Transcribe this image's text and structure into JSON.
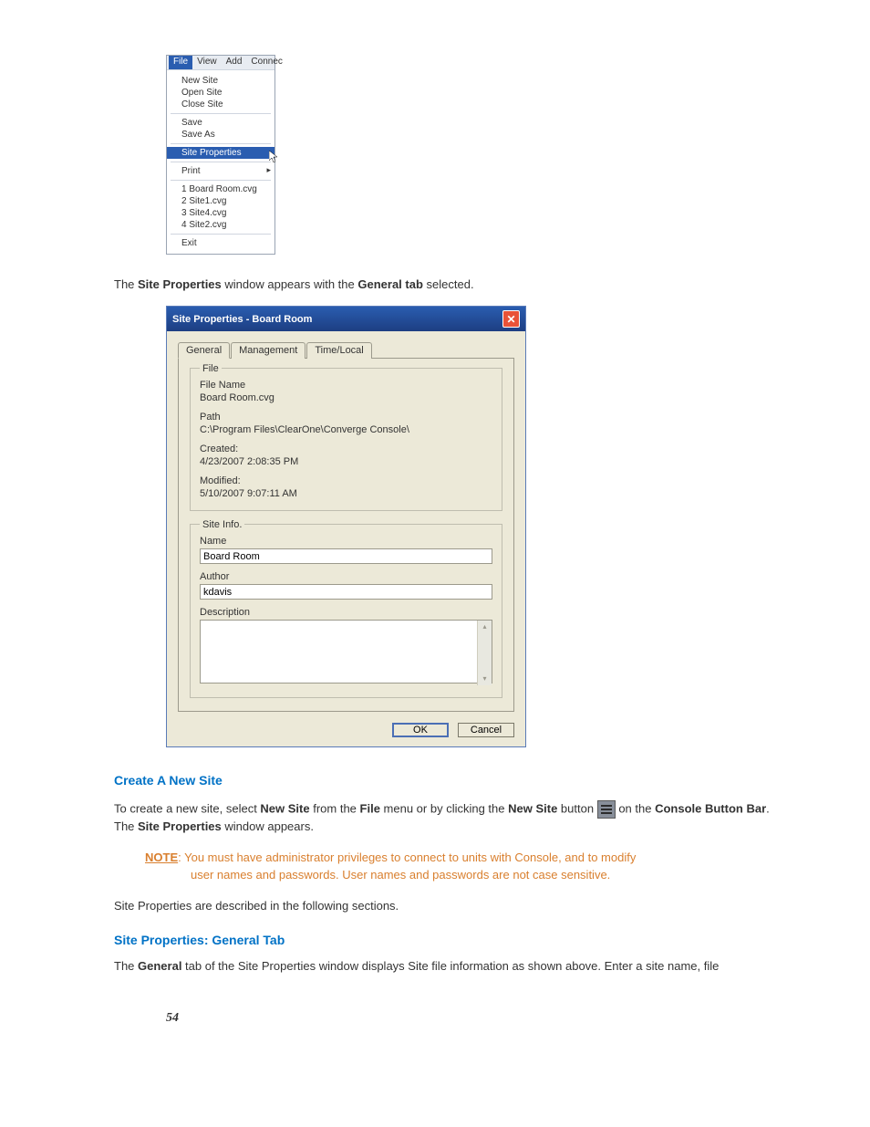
{
  "menu": {
    "bar": [
      "File",
      "View",
      "Add",
      "Connec"
    ],
    "groups": [
      [
        "New Site",
        "Open Site",
        "Close Site"
      ],
      [
        "Save",
        "Save As"
      ],
      [
        "Site Properties"
      ],
      [
        "Print"
      ],
      [
        "1  Board Room.cvg",
        "2  Site1.cvg",
        "3  Site4.cvg",
        "4  Site2.cvg"
      ],
      [
        "Exit"
      ]
    ],
    "highlighted": "Site Properties",
    "submenu_arrow_on": "Print"
  },
  "intro_line": {
    "pre": "The ",
    "b1": "Site Properties",
    "mid": " window appears with the ",
    "b2": "General tab",
    "post": " selected."
  },
  "dialog": {
    "title": "Site Properties - Board Room",
    "tabs": [
      "General",
      "Management",
      "Time/Local"
    ],
    "active_tab": "General",
    "file_group": {
      "legend": "File",
      "items": [
        {
          "k": "File Name",
          "v": "Board Room.cvg"
        },
        {
          "k": "Path",
          "v": "C:\\Program Files\\ClearOne\\Converge Console\\"
        },
        {
          "k": "Created:",
          "v": "4/23/2007 2:08:35 PM"
        },
        {
          "k": "Modified:",
          "v": "5/10/2007 9:07:11 AM"
        }
      ]
    },
    "site_group": {
      "legend": "Site Info.",
      "name_label": "Name",
      "name_value": "Board Room",
      "author_label": "Author",
      "author_value": "kdavis",
      "desc_label": "Description",
      "desc_value": ""
    },
    "buttons": {
      "ok": "OK",
      "cancel": "Cancel"
    }
  },
  "create_heading": "Create A New Site",
  "create_p": {
    "t1": "To create a new site, select ",
    "b1": "New Site",
    "t2": " from the ",
    "b2": "File",
    "t3": " menu or by clicking the ",
    "b3": "New Site",
    "t4": " button ",
    "t5": " on the ",
    "b4": "Console Button Bar",
    "t6": ". The ",
    "b5": "Site Properties",
    "t7": " window appears."
  },
  "note": {
    "label": "NOTE",
    "text1": ": You must have administrator privileges to connect to units with Console, and to modify",
    "text2": "user names and passwords. User names and passwords are not case sensitive."
  },
  "after_note": "Site Properties are described in the following sections.",
  "general_heading": "Site Properties: General Tab",
  "general_p": {
    "t1": "The ",
    "b1": "General",
    "t2": " tab of the Site Properties window displays Site file information as shown above. Enter a site name, file"
  },
  "page_number": "54"
}
